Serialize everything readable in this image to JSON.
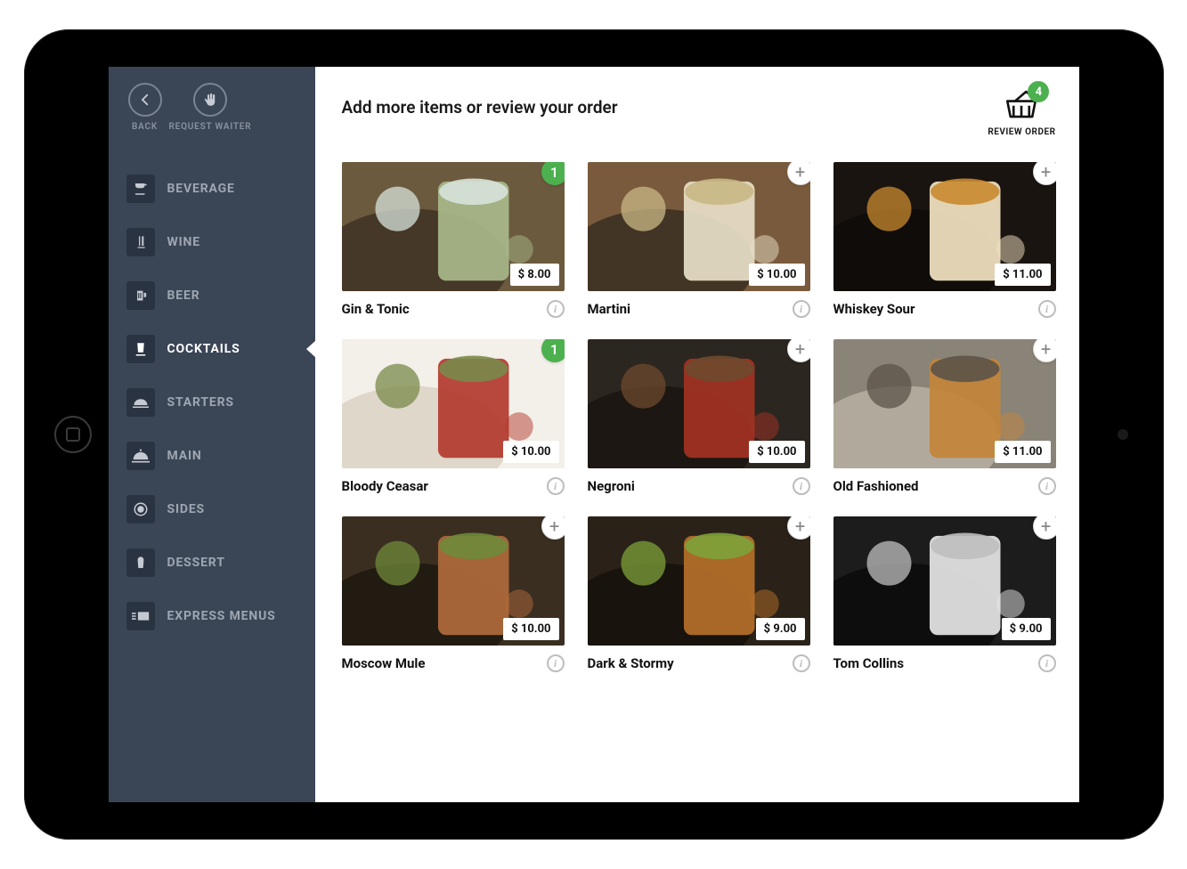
{
  "sidebar": {
    "back_label": "BACK",
    "waiter_label": "REQUEST WAITER",
    "categories": [
      {
        "label": "BEVERAGE",
        "icon": "cup-icon",
        "active": false
      },
      {
        "label": "WINE",
        "icon": "wine-icon",
        "active": false
      },
      {
        "label": "BEER",
        "icon": "beer-icon",
        "active": false
      },
      {
        "label": "COCKTAILS",
        "icon": "cocktail-icon",
        "active": true
      },
      {
        "label": "STARTERS",
        "icon": "starter-icon",
        "active": false
      },
      {
        "label": "MAIN",
        "icon": "main-icon",
        "active": false
      },
      {
        "label": "SIDES",
        "icon": "sides-icon",
        "active": false
      },
      {
        "label": "DESSERT",
        "icon": "dessert-icon",
        "active": false
      },
      {
        "label": "EXPRESS MENUS",
        "icon": "express-icon",
        "active": false
      }
    ]
  },
  "header": {
    "title": "Add more items or review your order",
    "review_label": "REVIEW ORDER",
    "cart_count": "4"
  },
  "items": [
    {
      "name": "Gin & Tonic",
      "price": "$ 8.00",
      "qty": "1",
      "palette": [
        "#6b5a3e",
        "#a8b88a",
        "#d7e3d9",
        "#3f3324"
      ]
    },
    {
      "name": "Martini",
      "price": "$ 10.00",
      "qty": null,
      "palette": [
        "#7a5a3c",
        "#e8e0c8",
        "#c9b885",
        "#3a2f22"
      ]
    },
    {
      "name": "Whiskey Sour",
      "price": "$ 11.00",
      "qty": null,
      "palette": [
        "#1a1410",
        "#f2e4c2",
        "#c98a2f",
        "#0e0b08"
      ]
    },
    {
      "name": "Bloody Ceasar",
      "price": "$ 10.00",
      "qty": "1",
      "palette": [
        "#f3efe9",
        "#b33a2e",
        "#7a8a4a",
        "#d9d2c4"
      ]
    },
    {
      "name": "Negroni",
      "price": "$ 10.00",
      "qty": null,
      "palette": [
        "#2c2620",
        "#a33223",
        "#6e4a2e",
        "#1a1510"
      ]
    },
    {
      "name": "Old Fashioned",
      "price": "$ 11.00",
      "qty": null,
      "palette": [
        "#8a8478",
        "#c3843a",
        "#5c5348",
        "#b7b0a2"
      ]
    },
    {
      "name": "Moscow Mule",
      "price": "$ 10.00",
      "qty": null,
      "palette": [
        "#3a2e20",
        "#b06a3c",
        "#6f8a3a",
        "#1f1810"
      ]
    },
    {
      "name": "Dark & Stormy",
      "price": "$ 9.00",
      "qty": null,
      "palette": [
        "#2a2218",
        "#b6702a",
        "#7da23a",
        "#15100a"
      ]
    },
    {
      "name": "Tom Collins",
      "price": "$ 9.00",
      "qty": null,
      "palette": [
        "#1c1c1c",
        "#e6e6e6",
        "#bfbfbf",
        "#0a0a0a"
      ]
    }
  ]
}
